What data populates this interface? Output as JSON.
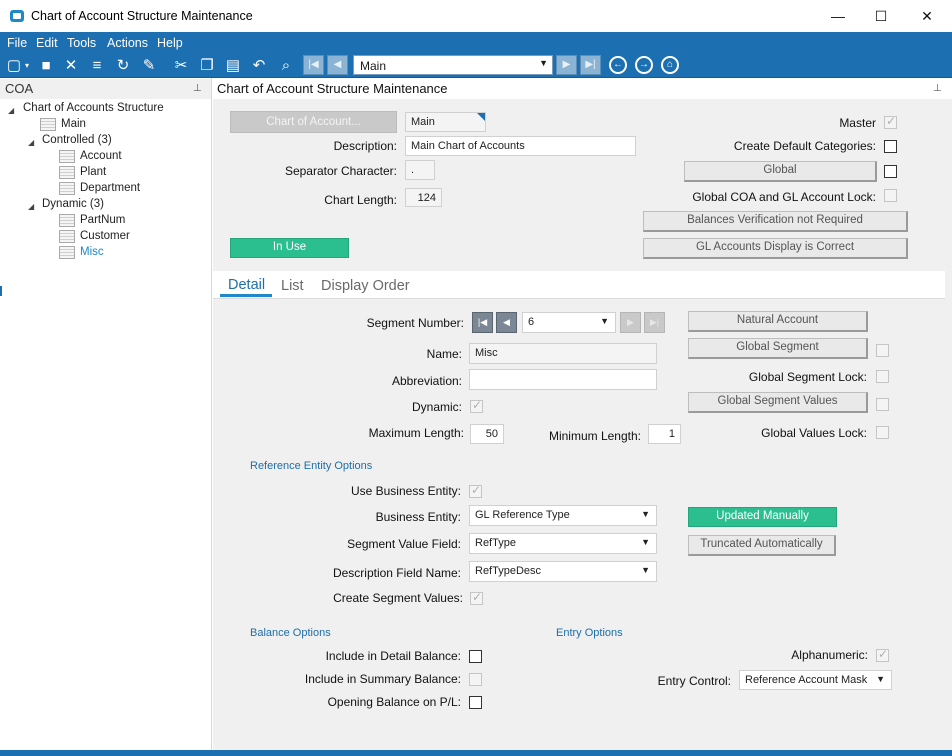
{
  "window": {
    "title": "Chart of Account Structure Maintenance",
    "minimize": "—",
    "maximize": "☐",
    "close": "✕"
  },
  "menu": [
    "File",
    "Edit",
    "Tools",
    "Actions",
    "Help"
  ],
  "toolbar": {
    "combo_value": "Main"
  },
  "left_panel": {
    "title": "COA",
    "pin": "⊥",
    "tree": {
      "root": "Chart of Accounts Structure",
      "main": "Main",
      "controlled": "Controlled (3)",
      "controlled_items": [
        "Account",
        "Plant",
        "Department"
      ],
      "dynamic": "Dynamic (3)",
      "dynamic_items": [
        "PartNum",
        "Customer",
        "Misc"
      ]
    }
  },
  "right_panel": {
    "title": "Chart of Account Structure Maintenance",
    "pin": "⊥"
  },
  "header_form": {
    "chart_of_account_btn": "Chart of Account...",
    "chart_value": "Main",
    "description_label": "Description:",
    "description_value": "Main Chart of Accounts",
    "separator_label": "Separator Character:",
    "separator_value": ".",
    "chart_length_label": "Chart Length:",
    "chart_length_value": "124",
    "in_use_btn": "In Use",
    "master_label": "Master",
    "create_default_label": "Create Default Categories:",
    "global_btn": "Global",
    "global_coa_lock_label": "Global COA and GL Account Lock:",
    "balances_btn": "Balances Verification not Required",
    "gl_display_btn": "GL Accounts Display is Correct"
  },
  "tabs": [
    "Detail",
    "List",
    "Display Order"
  ],
  "detail": {
    "segment_number_label": "Segment Number:",
    "segment_number_value": "6",
    "name_label": "Name:",
    "name_value": "Misc",
    "abbreviation_label": "Abbreviation:",
    "abbreviation_value": "",
    "dynamic_label": "Dynamic:",
    "max_length_label": "Maximum Length:",
    "max_length_value": "50",
    "min_length_label": "Minimum Length:",
    "min_length_value": "1",
    "natural_account_btn": "Natural Account",
    "global_segment_btn": "Global Segment",
    "global_segment_lock_label": "Global Segment Lock:",
    "global_segment_values_btn": "Global Segment Values",
    "global_values_lock_label": "Global Values Lock:"
  },
  "reference_entity": {
    "section_title": "Reference Entity Options",
    "use_business_entity_label": "Use Business Entity:",
    "business_entity_label": "Business Entity:",
    "business_entity_value": "GL Reference Type",
    "segment_value_field_label": "Segment Value Field:",
    "segment_value_field_value": "RefType",
    "description_field_name_label": "Description Field Name:",
    "description_field_name_value": "RefTypeDesc",
    "create_segment_values_label": "Create Segment Values:",
    "updated_manually_btn": "Updated Manually",
    "truncated_auto_btn": "Truncated Automatically"
  },
  "balance_options": {
    "section_title": "Balance Options",
    "include_detail_label": "Include in Detail Balance:",
    "include_summary_label": "Include in Summary Balance:",
    "opening_balance_label": "Opening Balance on P/L:"
  },
  "entry_options": {
    "section_title": "Entry Options",
    "alphanumeric_label": "Alphanumeric:",
    "entry_control_label": "Entry Control:",
    "entry_control_value": "Reference Account Mask"
  }
}
